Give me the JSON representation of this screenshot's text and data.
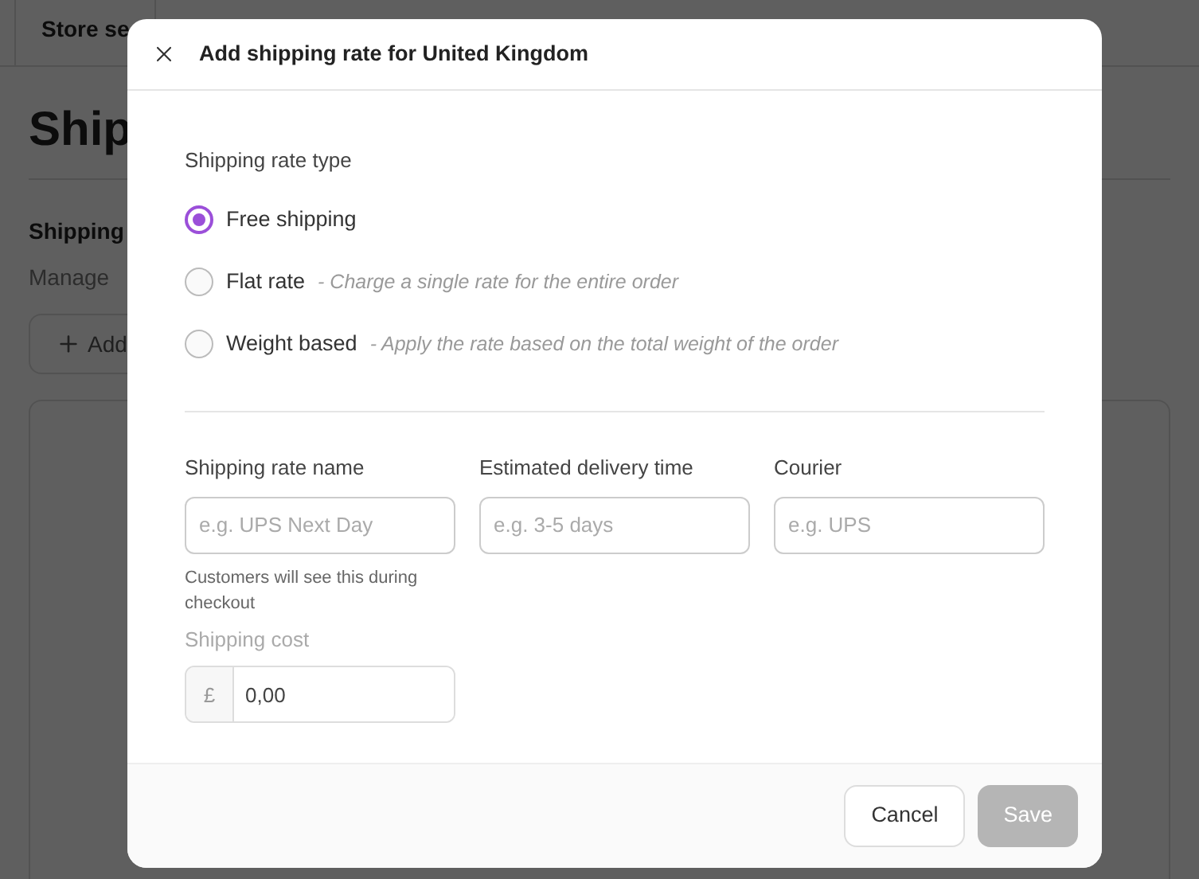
{
  "background": {
    "tab": "Store se",
    "heading": "Ship",
    "section_title": "Shipping",
    "section_text": "Manage",
    "add_button": "Add"
  },
  "dialog": {
    "title": "Add shipping rate for United Kingdom",
    "rate_type": {
      "label": "Shipping rate type",
      "options": [
        {
          "label": "Free shipping",
          "selected": true
        },
        {
          "label": "Flat rate",
          "hint": "- Charge a single rate for the entire order",
          "selected": false
        },
        {
          "label": "Weight based",
          "hint": "- Apply the rate based on the total weight of the order",
          "selected": false
        }
      ]
    },
    "fields": [
      {
        "label": "Shipping rate name",
        "placeholder": "e.g. UPS Next Day",
        "help": "Customers will see this during checkout"
      },
      {
        "label": "Estimated delivery time",
        "placeholder": "e.g. 3-5 days"
      },
      {
        "label": "Courier",
        "placeholder": "e.g. UPS"
      }
    ],
    "cost": {
      "label": "Shipping cost",
      "currency": "£",
      "value": "0,00",
      "disabled": true
    },
    "buttons": [
      {
        "label": "Cancel",
        "kind": "secondary",
        "disabled": false
      },
      {
        "label": "Save",
        "kind": "primary",
        "disabled": true
      }
    ]
  }
}
